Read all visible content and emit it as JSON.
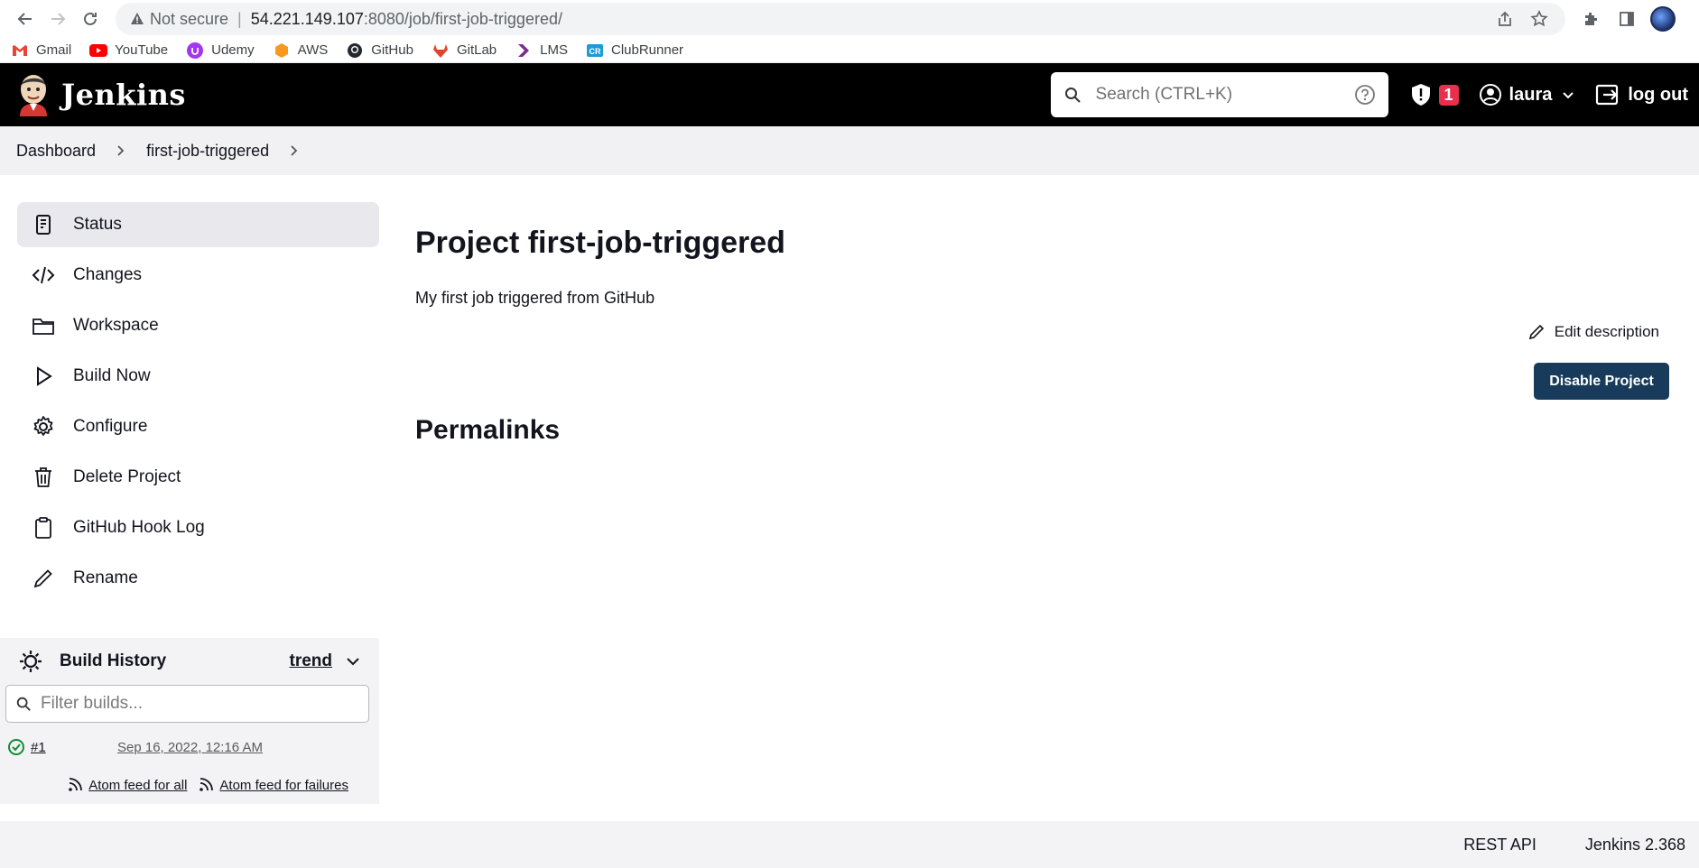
{
  "browser": {
    "security_label": "Not secure",
    "url_host": "54.221.149.107",
    "url_path": ":8080/job/first-job-triggered/",
    "bookmarks": [
      {
        "label": "Gmail",
        "icon": "gmail-icon",
        "color": "#ea4335"
      },
      {
        "label": "YouTube",
        "icon": "youtube-icon",
        "color": "#ff0000"
      },
      {
        "label": "Udemy",
        "icon": "udemy-icon",
        "color": "#a435f0"
      },
      {
        "label": "AWS",
        "icon": "aws-icon",
        "color": "#f7981f"
      },
      {
        "label": "GitHub",
        "icon": "github-icon",
        "color": "#24292f"
      },
      {
        "label": "GitLab",
        "icon": "gitlab-icon",
        "color": "#e24329"
      },
      {
        "label": "LMS",
        "icon": "lms-icon",
        "color": "#7b2d8e"
      },
      {
        "label": "ClubRunner",
        "icon": "clubrunner-icon",
        "color": "#1e9bd7"
      }
    ]
  },
  "header": {
    "title": "Jenkins",
    "search_placeholder": "Search (CTRL+K)",
    "security_count": "1",
    "user": "laura",
    "logout": "log out"
  },
  "breadcrumb": {
    "items": [
      "Dashboard",
      "first-job-triggered"
    ]
  },
  "side_tasks": [
    {
      "label": "Status",
      "icon": "status-icon",
      "active": true
    },
    {
      "label": "Changes",
      "icon": "code-icon"
    },
    {
      "label": "Workspace",
      "icon": "folder-icon"
    },
    {
      "label": "Build Now",
      "icon": "play-icon"
    },
    {
      "label": "Configure",
      "icon": "gear-icon"
    },
    {
      "label": "Delete Project",
      "icon": "trash-icon"
    },
    {
      "label": "GitHub Hook Log",
      "icon": "clipboard-icon"
    },
    {
      "label": "Rename",
      "icon": "pencil-icon"
    }
  ],
  "build_history": {
    "title": "Build History",
    "trend": "trend",
    "filter_placeholder": "Filter builds...",
    "builds": [
      {
        "number": "#1",
        "date": "Sep 16, 2022, 12:16 AM",
        "status": "success"
      }
    ],
    "feed_all": "Atom feed for all",
    "feed_failures": "Atom feed for failures"
  },
  "main": {
    "title": "Project first-job-triggered",
    "description": "My first job triggered from GitHub",
    "edit_description": "Edit description",
    "disable_button": "Disable Project",
    "permalinks": "Permalinks"
  },
  "footer": {
    "rest_api": "REST API",
    "version": "Jenkins 2.368"
  },
  "colors": {
    "header_bg": "#000000",
    "badge": "#e6304c",
    "primary_button": "#183b5c",
    "success": "#138a36"
  }
}
